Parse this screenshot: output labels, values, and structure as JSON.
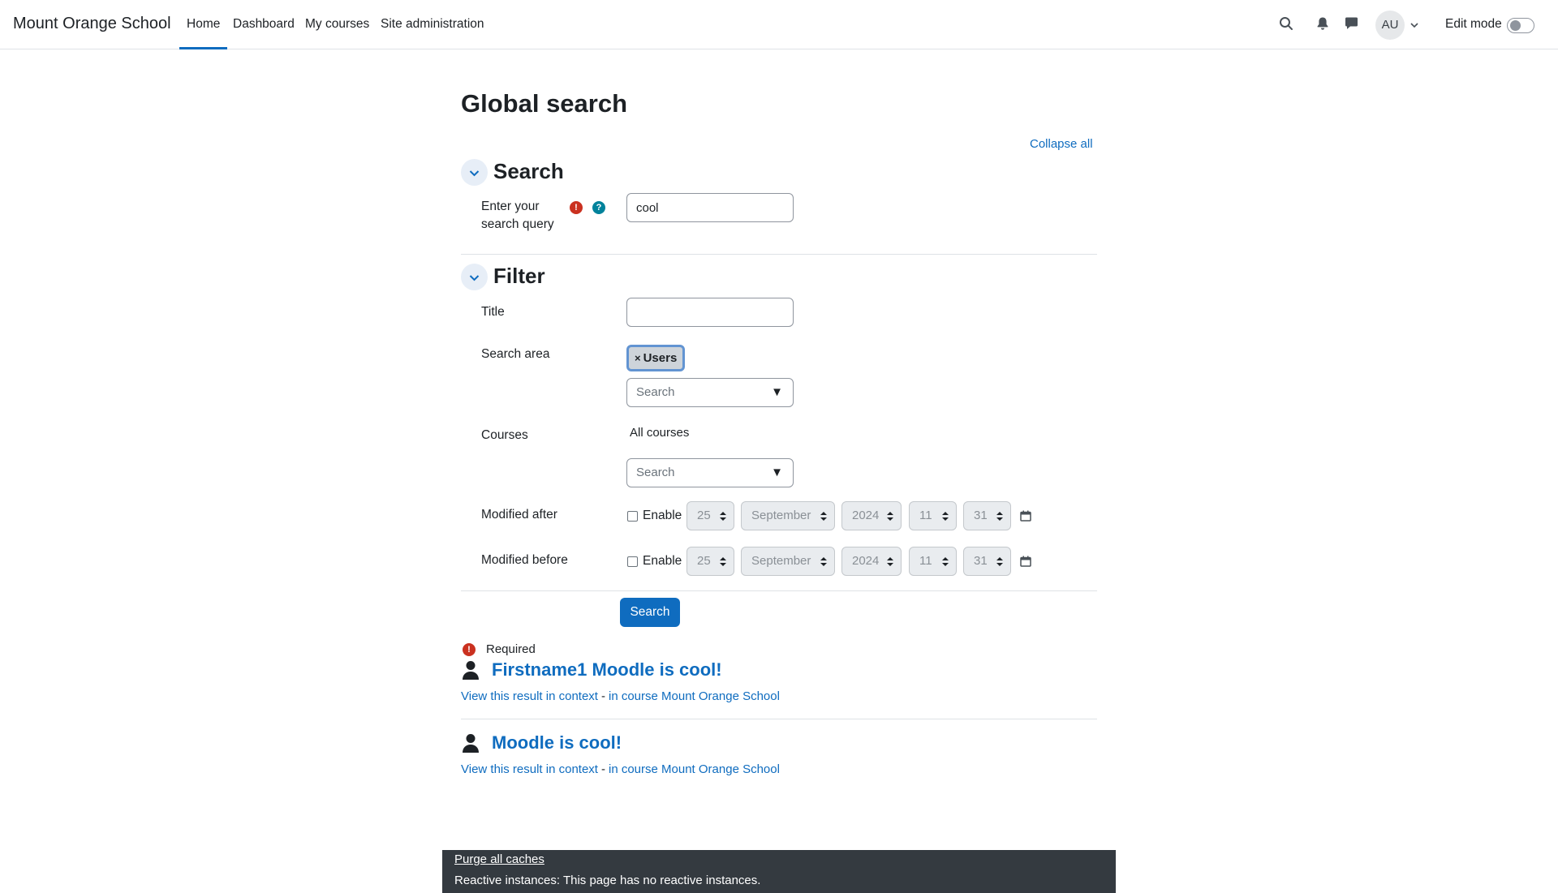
{
  "navbar": {
    "brand": "Mount Orange School",
    "items": [
      {
        "label": "Home",
        "active": true
      },
      {
        "label": "Dashboard"
      },
      {
        "label": "My courses"
      },
      {
        "label": "Site administration"
      }
    ],
    "icons": [
      "search-icon",
      "bell-icon",
      "chat-icon"
    ],
    "avatar_initials": "AU",
    "edit_mode_label": "Edit mode",
    "edit_mode_on": false
  },
  "page": {
    "title": "Global search",
    "collapse_all": "Collapse all"
  },
  "search_section": {
    "title": "Search",
    "query_label_line1": "Enter your",
    "query_label_line2": "search query",
    "query_value": "cool"
  },
  "filter_section": {
    "title": "Filter",
    "title_label": "Title",
    "title_value": "",
    "search_area_label": "Search area",
    "search_area_selected": "Users",
    "search_area_placeholder": "Search",
    "courses_label": "Courses",
    "courses_value": "All courses",
    "courses_placeholder": "Search",
    "modified_after": {
      "label": "Modified after",
      "enable": "Enable",
      "enabled": false,
      "day": "25",
      "month": "September",
      "year": "2024",
      "hour": "11",
      "minute": "31"
    },
    "modified_before": {
      "label": "Modified before",
      "enable": "Enable",
      "enabled": false,
      "day": "25",
      "month": "September",
      "year": "2024",
      "hour": "11",
      "minute": "31"
    }
  },
  "search_button": "Search",
  "required_note": "Required",
  "results": [
    {
      "title": "Firstname1 Moodle is cool!",
      "context_link": "View this result in context",
      "separator": "-",
      "course_link": "in course Mount Orange School"
    },
    {
      "title": "Moodle is cool!",
      "context_link": "View this result in context",
      "separator": "-",
      "course_link": "in course Mount Orange School"
    }
  ],
  "footer": {
    "purge": "Purge all caches",
    "reactive": "Reactive instances: This page has no reactive instances."
  },
  "colors": {
    "accent": "#0f6cbf",
    "required": "#ca3120",
    "help": "#00829b",
    "footer_bg": "#343a40"
  }
}
